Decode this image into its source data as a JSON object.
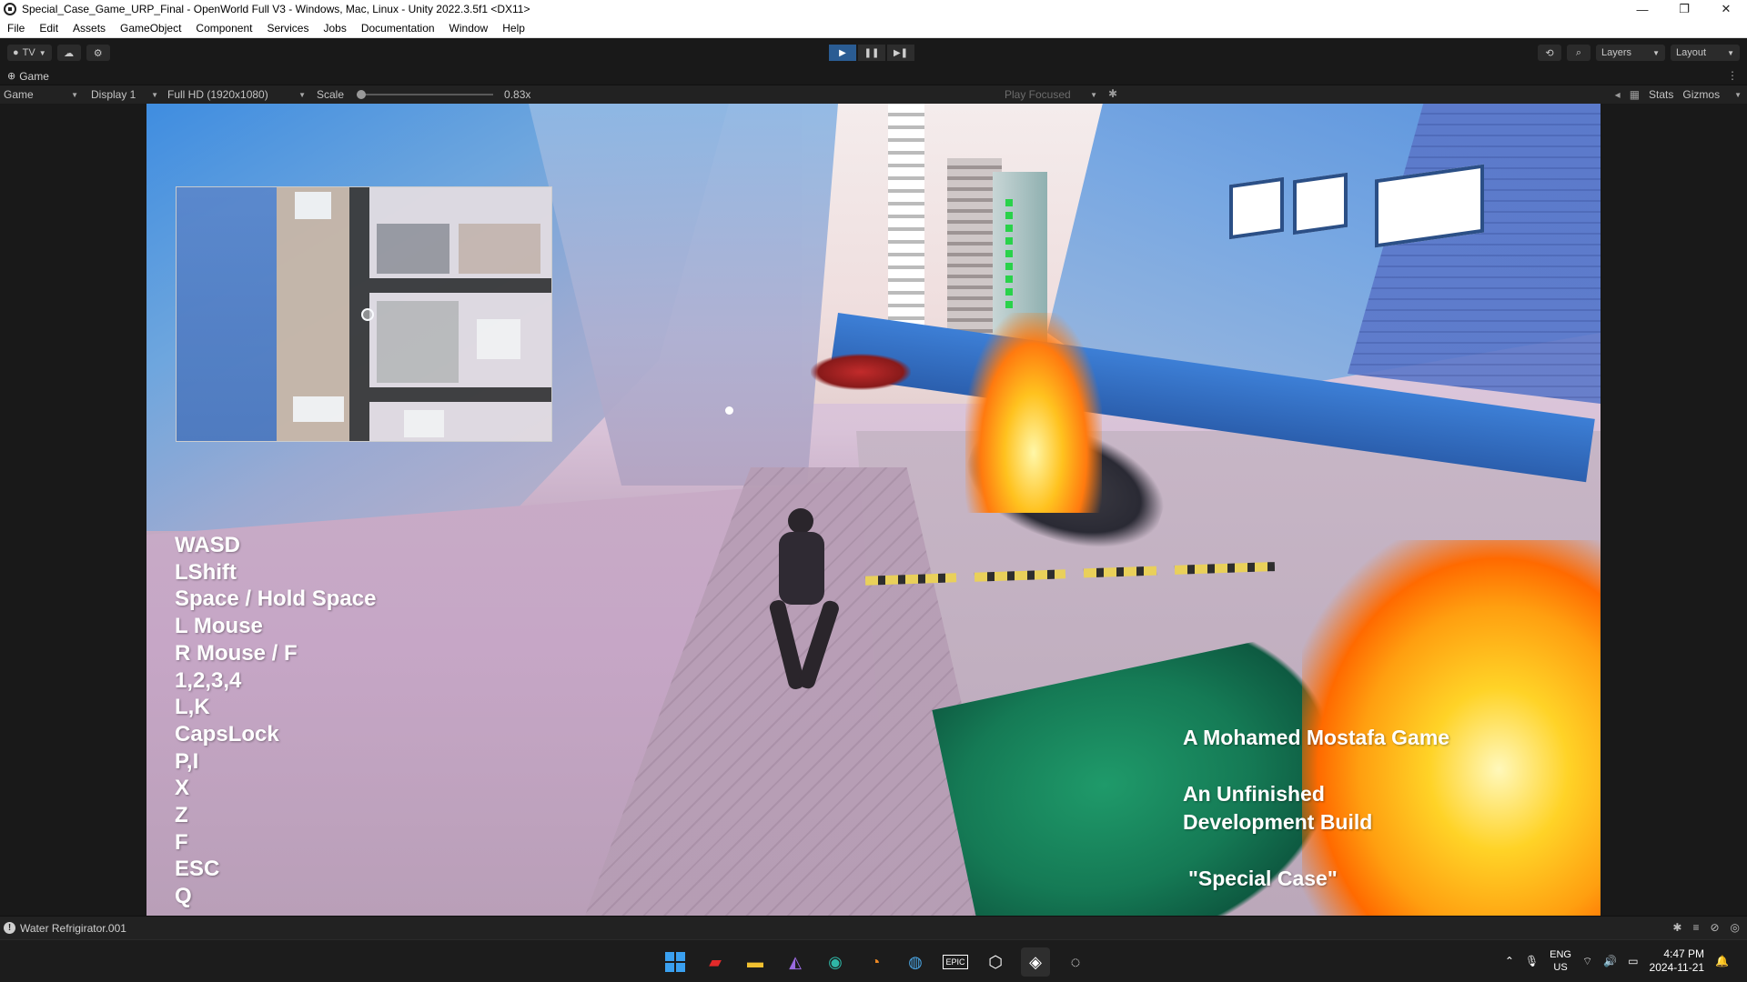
{
  "window": {
    "title": "Special_Case_Game_URP_Final - OpenWorld Full V3 - Windows, Mac, Linux - Unity 2022.3.5f1 <DX11>",
    "minimize": "—",
    "maximize": "❐",
    "close": "✕"
  },
  "menu": [
    "File",
    "Edit",
    "Assets",
    "GameObject",
    "Component",
    "Services",
    "Jobs",
    "Documentation",
    "Window",
    "Help"
  ],
  "toolbar": {
    "account_label": "TV",
    "layers_label": "Layers",
    "layout_label": "Layout"
  },
  "game_tab": {
    "label": "Game"
  },
  "game_controls": {
    "view_mode": "Game",
    "display": "Display 1",
    "resolution": "Full HD (1920x1080)",
    "scale_label": "Scale",
    "scale_value": "0.83x",
    "play_mode": "Play Focused",
    "stats": "Stats",
    "gizmos": "Gizmos"
  },
  "controls_hint": [
    "WASD",
    "LShift",
    "Space / Hold Space",
    "L Mouse",
    "R Mouse / F",
    "1,2,3,4",
    "L,K",
    "CapsLock",
    "P,I",
    "X",
    "Z",
    "F",
    "ESC",
    "Q"
  ],
  "credits": {
    "line1": "A Mohamed Mostafa Game",
    "line2": "An Unfinished",
    "line3": "Development Build",
    "line4": "\"Special Case\""
  },
  "status": {
    "message": "Water Refrigirator.001"
  },
  "taskbar": {
    "lang_top": "ENG",
    "lang_bottom": "US",
    "time": "4:47 PM",
    "date": "2024-11-21"
  },
  "colors": {
    "editor_bg": "#191919",
    "play_active": "#2a5c93",
    "controls_text": "#ffffff"
  }
}
